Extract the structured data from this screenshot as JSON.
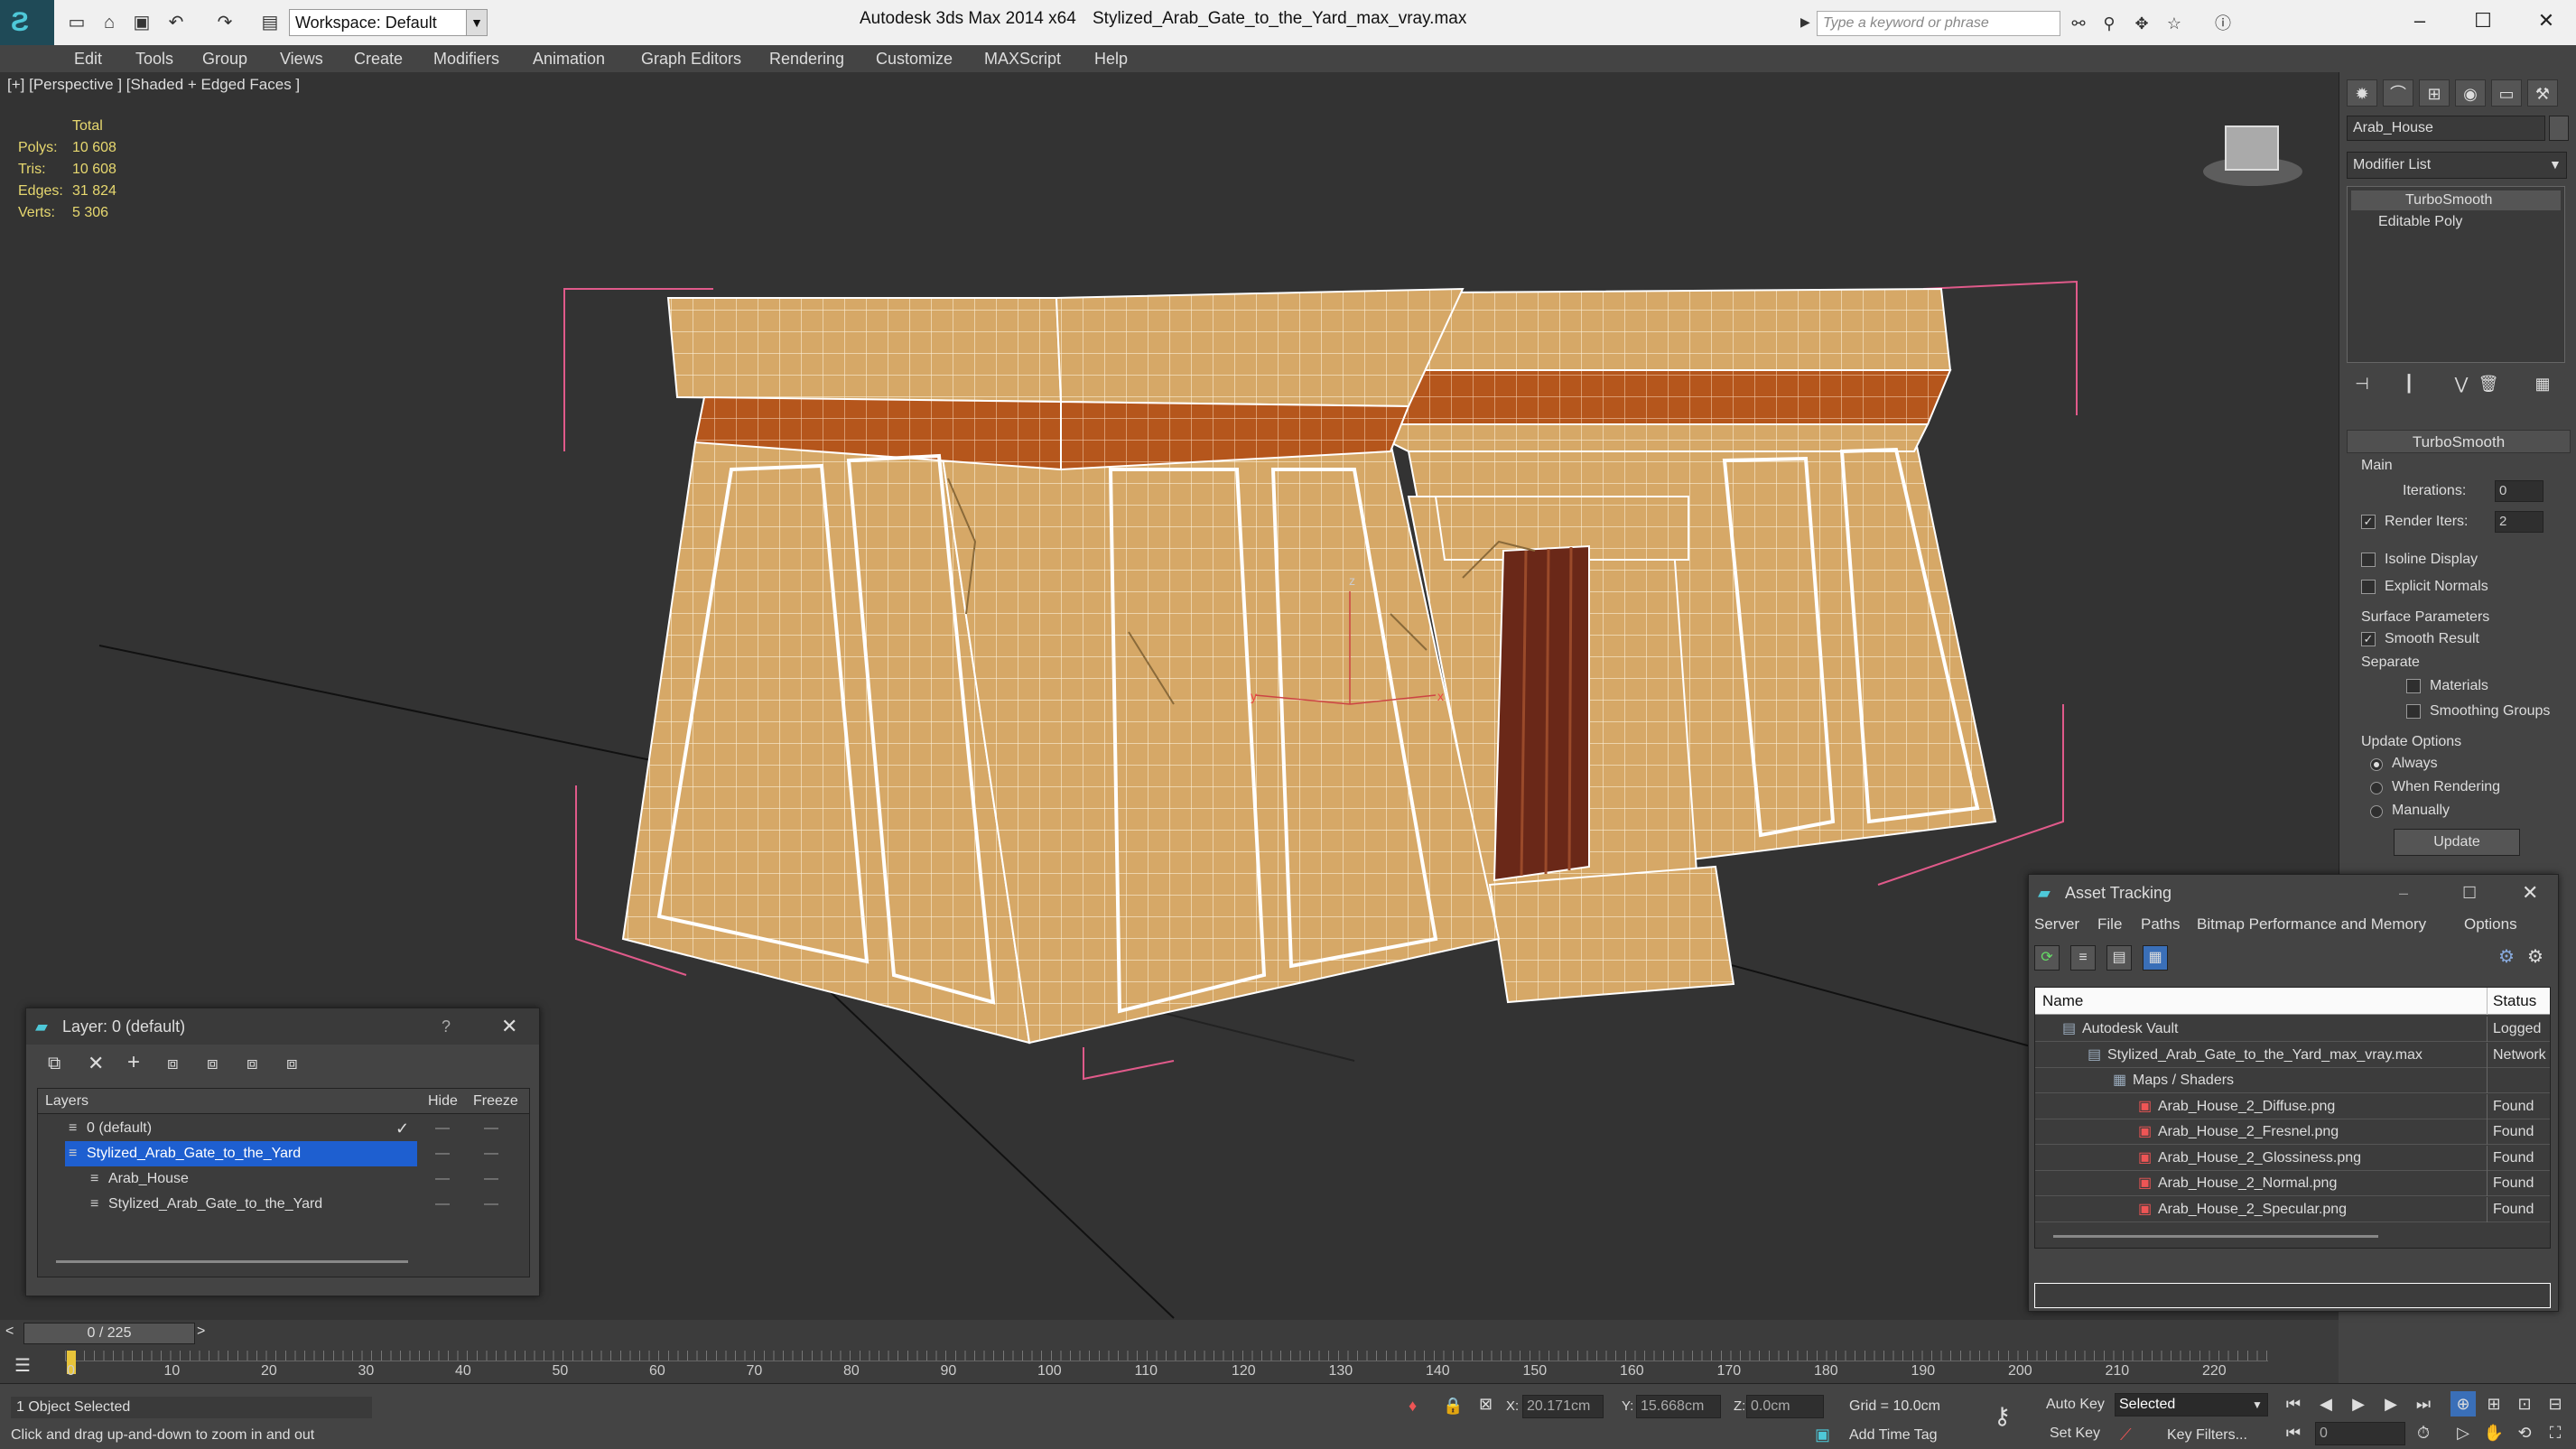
{
  "titlebar": {
    "workspace": "Workspace: Default",
    "app": "Autodesk 3ds Max  2014 x64",
    "file": "Stylized_Arab_Gate_to_the_Yard_max_vray.max",
    "search_placeholder": "Type a keyword or phrase"
  },
  "menu": [
    "Edit",
    "Tools",
    "Group",
    "Views",
    "Create",
    "Modifiers",
    "Animation",
    "Graph Editors",
    "Rendering",
    "Customize",
    "MAXScript",
    "Help"
  ],
  "viewport": {
    "label": "[+] [Perspective ] [Shaded + Edged Faces ]",
    "stats_header": "Total",
    "stats": [
      {
        "label": "Polys:",
        "value": "10 608"
      },
      {
        "label": "Tris:",
        "value": "10 608"
      },
      {
        "label": "Edges:",
        "value": "31 824"
      },
      {
        "label": "Verts:",
        "value": "5 306"
      }
    ],
    "gizmo_labels": {
      "x": "x",
      "y": "y",
      "z": "z"
    }
  },
  "command_panel": {
    "object_name": "Arab_House",
    "modifier_list": "Modifier List",
    "stack": [
      "TurboSmooth",
      "Editable Poly"
    ],
    "turbosmooth": {
      "title": "TurboSmooth",
      "main": "Main",
      "iterations_label": "Iterations:",
      "iterations": "0",
      "render_iters_label": "Render Iters:",
      "render_iters": "2",
      "render_iters_checked": true,
      "isoline": "Isoline Display",
      "explicit_normals": "Explicit Normals",
      "surface_params": "Surface Parameters",
      "smooth_result": "Smooth Result",
      "separate": "Separate",
      "materials": "Materials",
      "smoothing_groups": "Smoothing Groups",
      "update_options": "Update Options",
      "always": "Always",
      "when_rendering": "When Rendering",
      "manually": "Manually",
      "update_button": "Update"
    }
  },
  "layer_panel": {
    "title": "Layer: 0 (default)",
    "help": "?",
    "columns": {
      "layers": "Layers",
      "hide": "Hide",
      "freeze": "Freeze"
    },
    "rows": [
      {
        "name": "0 (default)",
        "indent": 0,
        "selected": false,
        "check": "✓"
      },
      {
        "name": "Stylized_Arab_Gate_to_the_Yard",
        "indent": 0,
        "selected": true,
        "check": ""
      },
      {
        "name": "Arab_House",
        "indent": 1,
        "selected": false,
        "check": ""
      },
      {
        "name": "Stylized_Arab_Gate_to_the_Yard",
        "indent": 1,
        "selected": false,
        "check": ""
      }
    ]
  },
  "asset_panel": {
    "title": "Asset Tracking",
    "menu": [
      "Server",
      "File",
      "Paths",
      "Bitmap Performance and Memory",
      "Options"
    ],
    "columns": {
      "name": "Name",
      "status": "Status"
    },
    "rows": [
      {
        "name": "Autodesk Vault",
        "indent": 0,
        "status": "Logged O"
      },
      {
        "name": "Stylized_Arab_Gate_to_the_Yard_max_vray.max",
        "indent": 1,
        "status": "Network"
      },
      {
        "name": "Maps / Shaders",
        "indent": 2,
        "status": ""
      },
      {
        "name": "Arab_House_2_Diffuse.png",
        "indent": 3,
        "status": "Found"
      },
      {
        "name": "Arab_House_2_Fresnel.png",
        "indent": 3,
        "status": "Found"
      },
      {
        "name": "Arab_House_2_Glossiness.png",
        "indent": 3,
        "status": "Found"
      },
      {
        "name": "Arab_House_2_Normal.png",
        "indent": 3,
        "status": "Found"
      },
      {
        "name": "Arab_House_2_Specular.png",
        "indent": 3,
        "status": "Found"
      }
    ]
  },
  "timeline": {
    "frame": "0 / 225",
    "ticks": [
      "0",
      "10",
      "20",
      "30",
      "40",
      "50",
      "60",
      "70",
      "80",
      "90",
      "100",
      "110",
      "120",
      "130",
      "140",
      "150",
      "160",
      "170",
      "180",
      "190",
      "200",
      "210",
      "220"
    ]
  },
  "status": {
    "selected": "1 Object Selected",
    "hint": "Click and drag up-and-down to zoom in and out",
    "x_label": "X:",
    "x": "20.171cm",
    "y_label": "Y:",
    "y": "15.668cm",
    "z_label": "Z:",
    "z": "0.0cm",
    "grid": "Grid = 10.0cm",
    "auto_key": "Auto Key",
    "selected_dropdown": "Selected",
    "set_key": "Set Key",
    "key_filters": "Key Filters...",
    "add_time_tag": "Add Time Tag",
    "frame_field": "0"
  },
  "colors": {
    "selection": "#1e5fd0",
    "stats": "#e7d86f",
    "wall": "#d6a867",
    "band": "#b5561c"
  }
}
